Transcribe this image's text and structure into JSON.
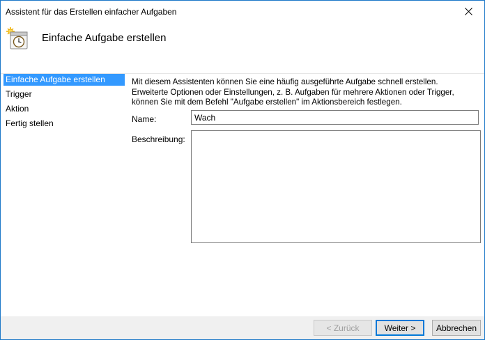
{
  "window": {
    "title": "Assistent für das Erstellen einfacher Aufgaben",
    "close_glyph": "✕"
  },
  "header": {
    "title": "Einfache Aufgabe erstellen",
    "icon": "task-scheduler-clock-icon"
  },
  "sidebar": {
    "items": [
      {
        "label": "Einfache Aufgabe erstellen",
        "active": true
      },
      {
        "label": "Trigger",
        "active": false
      },
      {
        "label": "Aktion",
        "active": false
      },
      {
        "label": "Fertig stellen",
        "active": false
      }
    ]
  },
  "main": {
    "intro_lines": [
      "Mit diesem Assistenten können Sie eine häufig ausgeführte Aufgabe schnell erstellen.",
      "Erweiterte Optionen oder Einstellungen, z. B. Aufgaben für mehrere Aktionen oder Trigger,",
      "können Sie mit dem Befehl \"Aufgabe erstellen\" im Aktionsbereich festlegen."
    ],
    "name_label": "Name:",
    "name_value": "Wach",
    "description_label": "Beschreibung:",
    "description_value": ""
  },
  "footer": {
    "back_label": "< Zurück",
    "next_label": "Weiter >",
    "cancel_label": "Abbrechen"
  },
  "colors": {
    "accent": "#3399ff",
    "window_border": "#1c78c8",
    "footer_bg": "#f0f0f0"
  }
}
